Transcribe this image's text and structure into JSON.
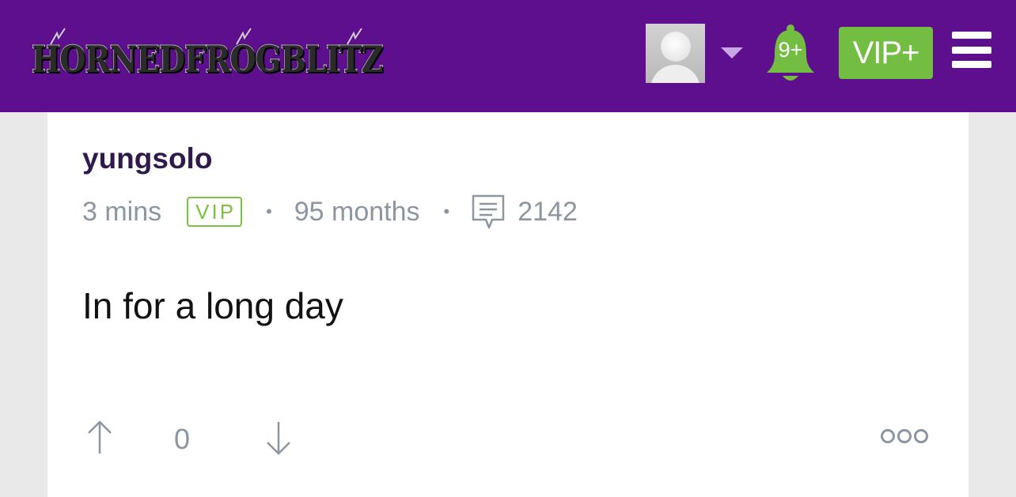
{
  "header": {
    "logo_text": "HornedFrogBlitz",
    "notification_count": "9+",
    "vip_plus_label": "VIP+",
    "icons": [
      "avatar",
      "chevron-down-icon",
      "bell-icon",
      "menu-icon"
    ]
  },
  "post": {
    "username": "yungsolo",
    "time_ago": "3 mins",
    "badge": "VIP",
    "membership": "95 months",
    "post_count": "2142",
    "body": "In for a long day",
    "vote_count": "0"
  },
  "colors": {
    "header_bg": "#5d0f8d",
    "accent_green": "#74bd43",
    "username": "#2f1a4b",
    "meta_gray": "#8c96a0"
  }
}
